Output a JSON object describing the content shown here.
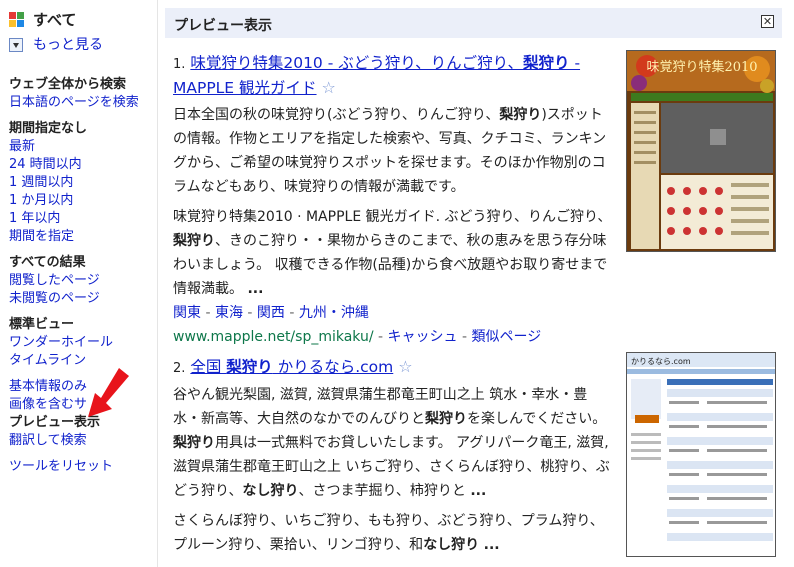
{
  "sidebar": {
    "all_label": "すべて",
    "more_label": "もっと見る",
    "sections": [
      {
        "heading": "ウェブ全体から検索",
        "items": [
          {
            "label": "日本語のページを検索",
            "selected": false
          }
        ]
      },
      {
        "heading": "期間指定なし",
        "items": [
          {
            "label": "最新",
            "selected": false
          },
          {
            "label": "24 時間以内",
            "selected": false
          },
          {
            "label": "1 週間以内",
            "selected": false
          },
          {
            "label": "1 か月以内",
            "selected": false
          },
          {
            "label": "1 年以内",
            "selected": false
          },
          {
            "label": "期間を指定",
            "selected": false
          }
        ]
      },
      {
        "heading": "すべての結果",
        "items": [
          {
            "label": "閲覧したページ",
            "selected": false
          },
          {
            "label": "未閲覧のページ",
            "selected": false
          }
        ]
      },
      {
        "heading": "標準ビュー",
        "items": [
          {
            "label": "ワンダーホイール",
            "selected": false
          },
          {
            "label": "タイムライン",
            "selected": false
          }
        ]
      },
      {
        "heading": "",
        "items": [
          {
            "label": "基本情報のみ",
            "selected": false
          },
          {
            "label": "画像を含むサ",
            "selected": false
          },
          {
            "label": "プレビュー表示",
            "selected": true
          },
          {
            "label": "翻訳して検索",
            "selected": false
          }
        ]
      },
      {
        "heading": "",
        "items": [
          {
            "label": "ツールをリセット",
            "selected": false
          }
        ]
      }
    ]
  },
  "preview": {
    "header": "プレビュー表示",
    "close_glyph": "✕"
  },
  "results": [
    {
      "num": "1.",
      "title_parts": [
        {
          "t": "味覚狩り特集2010 - ぶどう狩り、りんご狩り、",
          "b": false
        },
        {
          "t": "梨狩り",
          "b": true
        },
        {
          "t": " - MAPPLE 観光ガイド",
          "b": false
        }
      ],
      "star": "☆",
      "snippet_parts": [
        {
          "t": "日本全国の秋の味覚狩り(ぶどう狩り、りんご狩り、",
          "b": false
        },
        {
          "t": "梨狩り",
          "b": true
        },
        {
          "t": ")スポットの情報。作物とエリアを指定した検索や、写真、クチコミ、ランキングから、ご希望の味覚狩りスポットを探せます。そのほか作物別のコラムなどもあり、味覚狩りの情報が満載です。",
          "b": false
        }
      ],
      "extra_parts": [
        {
          "t": "味覚狩り特集2010 · MAPPLE 観光ガイド. ぶどう狩り、りんご狩り、",
          "b": false
        },
        {
          "t": "梨狩り",
          "b": true
        },
        {
          "t": "、きのこ狩り・・果物からきのこまで、秋の恵みを思う存分味わいましょう。 収穫できる作物(品種)から食べ放題やお取り寄せまで情報満載。 ",
          "b": false
        },
        {
          "t": "...",
          "b": true
        }
      ],
      "sublinks": [
        "関東",
        "東海",
        "関西",
        "九州・沖縄"
      ],
      "url": "www.mapple.net/sp_mikaku/",
      "cache_label": "キャッシュ",
      "similar_label": "類似ページ",
      "thumb_title": "味覚狩り特集2010"
    },
    {
      "num": "2.",
      "title_parts": [
        {
          "t": "全国 ",
          "b": false
        },
        {
          "t": "梨狩り",
          "b": true
        },
        {
          "t": " かりるなら.com",
          "b": false
        }
      ],
      "star": "☆",
      "snippet_parts": [
        {
          "t": "谷やん観光梨園, 滋賀, 滋賀県蒲生郡竜王町山之上 筑水・幸水・豊水・新高等、大自然のなかでのんびりと",
          "b": false
        },
        {
          "t": "梨狩り",
          "b": true
        },
        {
          "t": "を楽しんでください。",
          "b": false
        },
        {
          "t": "梨狩り",
          "b": true
        },
        {
          "t": "用具は一式無料でお貸しいたします。 アグリパーク竜王, 滋賀, 滋賀県蒲生郡竜王町山之上 いちご狩り、さくらんぼ狩り、桃狩り、ぶどう狩り、",
          "b": false
        },
        {
          "t": "なし狩り",
          "b": true
        },
        {
          "t": "、さつま芋掘り、柿狩りと ",
          "b": false
        },
        {
          "t": "...",
          "b": true
        }
      ],
      "extra_parts": [
        {
          "t": "さくらんぼ狩り、いちご狩り、もも狩り、ぶどう狩り、プラム狩り、プルーン狩り、栗拾い、リンゴ狩り、和",
          "b": false
        },
        {
          "t": "なし狩り",
          "b": true
        },
        {
          "t": " ",
          "b": false
        },
        {
          "t": "...",
          "b": true
        }
      ],
      "thumb_title": "かりるなら.com"
    }
  ],
  "colors": {
    "link": "#1122cc",
    "url_green": "#0e774a",
    "header_bg": "#ebeff9",
    "arrow_red": "#e8141b"
  }
}
